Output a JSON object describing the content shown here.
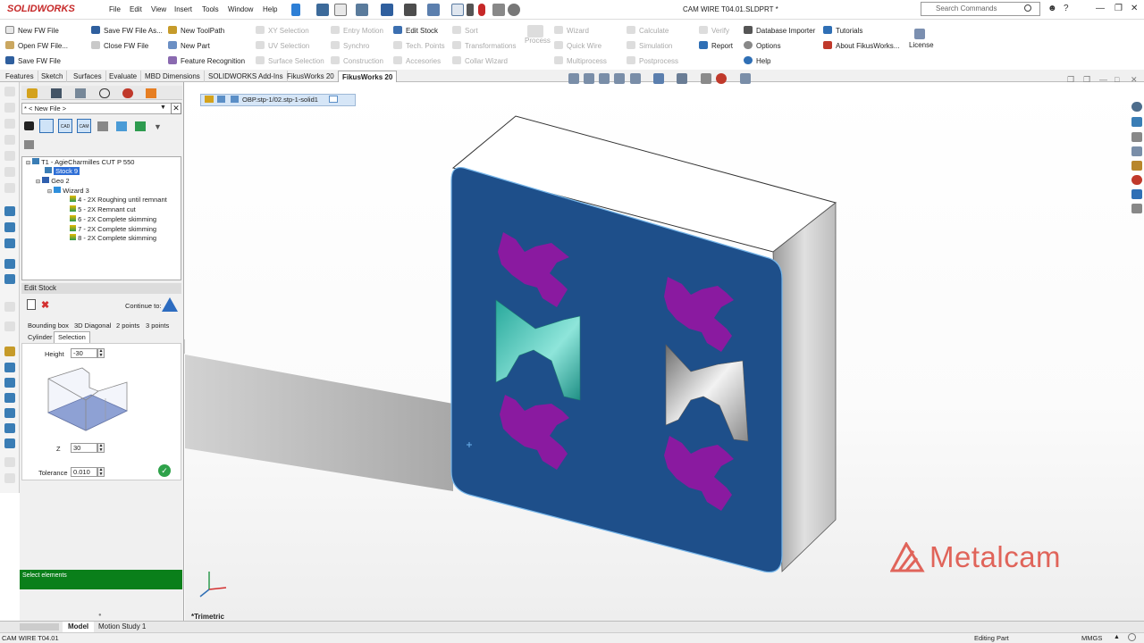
{
  "app": {
    "logo": "SOLIDWORKS",
    "title": "CAM WIRE T04.01.SLDPRT *",
    "search_placeholder": "Search Commands"
  },
  "menu": [
    "File",
    "Edit",
    "View",
    "Insert",
    "Tools",
    "Window",
    "Help"
  ],
  "ribbon": {
    "file": [
      "New FW File",
      "Open FW File...",
      "Save FW File",
      "Save FW File As...",
      "Close FW File"
    ],
    "tool": [
      "New ToolPath",
      "New Part",
      "Feature Recognition"
    ],
    "sel": [
      "XY Selection",
      "UV Selection",
      "Surface Selection"
    ],
    "motion": [
      "Entry Motion",
      "Synchro",
      "Construction"
    ],
    "stock": [
      "Edit Stock",
      "Tech. Points",
      "Accesories"
    ],
    "sort": [
      "Sort",
      "Transformations",
      "Collar Wizard"
    ],
    "process": "Process",
    "wizard": [
      "Wizard",
      "Quick Wire",
      "Multiprocess"
    ],
    "calc": [
      "Calculate",
      "Simulation",
      "Postprocess"
    ],
    "verify": [
      "Verify",
      "Report",
      "Help"
    ],
    "db": [
      "Database Importer",
      "Options"
    ],
    "tut": [
      "Tutorials",
      "About FikusWorks..."
    ],
    "license": "License"
  },
  "cm_tabs": [
    "Features",
    "Sketch",
    "Surfaces",
    "Evaluate",
    "MBD Dimensions",
    "SOLIDWORKS Add-Ins",
    "FikusWorks 20",
    "FikusWorks 20"
  ],
  "panel": {
    "newfile": "* < New File >",
    "tree": [
      "T1 - AgieCharmilles CUT P 550",
      "Stock 9",
      "Geo 2",
      "Wizard 3",
      "4 - 2X Roughing until remnant",
      "5 - 2X Remnant cut",
      "6 - 2X Complete skimming",
      "7 - 2X Complete skimming",
      "8 - 2X Complete skimming"
    ],
    "section": "Edit Stock",
    "continue_label": "Continue to:",
    "tabs1": [
      "Bounding box",
      "3D Diagonal",
      "2 points",
      "3 points"
    ],
    "tabs2": [
      "Cylinder",
      "Selection"
    ],
    "height_label": "Height",
    "height": "-30",
    "z_label": "Z",
    "z": "30",
    "tol_label": "Tolerance",
    "tol": "0.010",
    "status": "Select elements"
  },
  "viewport": {
    "breadcrumb": "OBP.stp-1/02.stp-1-solid1",
    "view": "*Trimetric",
    "brand": "Metalcam",
    "colors": {
      "face": "#1e4f8a",
      "pocket": "#8a1aa0",
      "cyan": "#3fbdb0"
    }
  },
  "bottom_tabs": [
    "Model",
    "Motion Study 1"
  ],
  "status": {
    "file": "CAM WIRE T04.01",
    "mode": "Editing Part",
    "units": "MMGS"
  }
}
